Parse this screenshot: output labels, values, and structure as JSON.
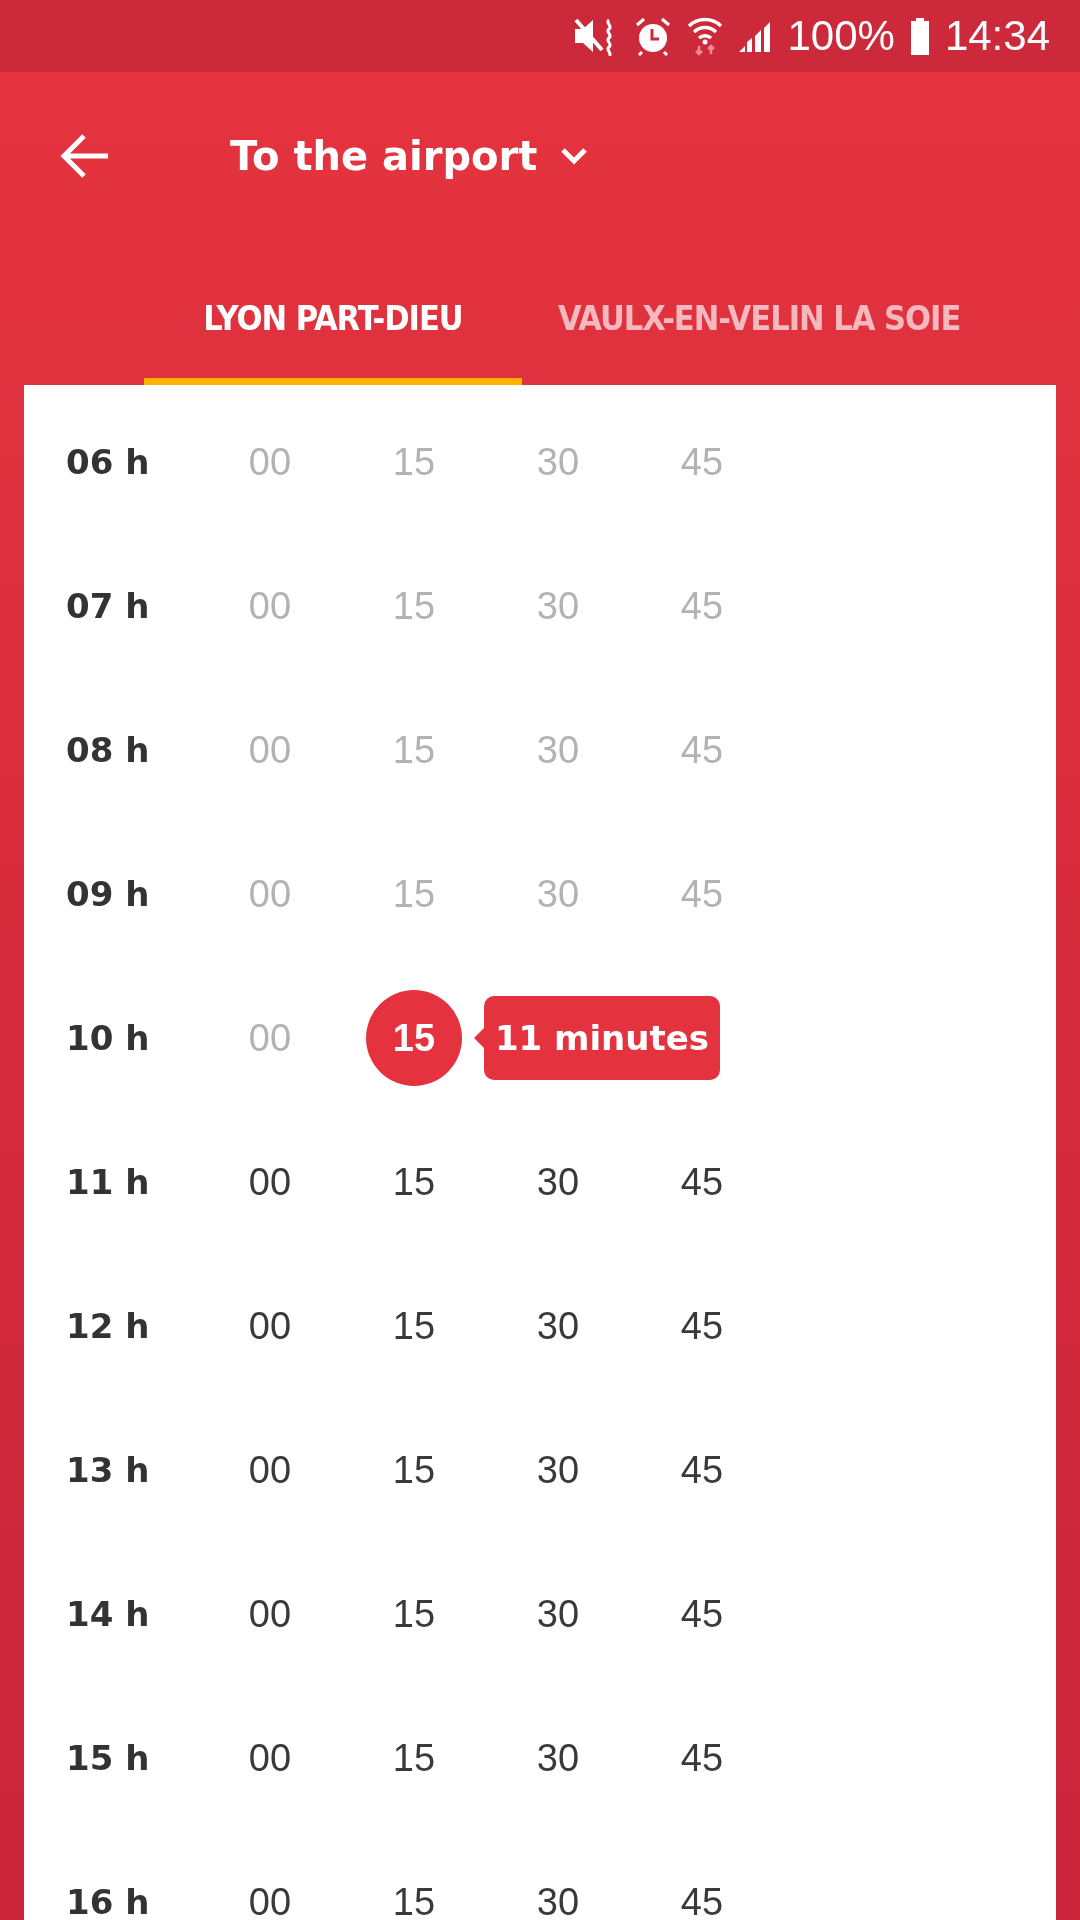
{
  "status_bar": {
    "battery": "100%",
    "time": "14:34"
  },
  "header": {
    "title": "To the airport"
  },
  "tabs": [
    {
      "label": "LYON PART-DIEU",
      "selected": true
    },
    {
      "label": "VAULX-EN-VELIN LA SOIE",
      "selected": false
    }
  ],
  "timetable": [
    {
      "hour": "06 h",
      "minutes": [
        {
          "label": "00",
          "past": true,
          "selected": false
        },
        {
          "label": "15",
          "past": true,
          "selected": false
        },
        {
          "label": "30",
          "past": true,
          "selected": false
        },
        {
          "label": "45",
          "past": true,
          "selected": false
        }
      ]
    },
    {
      "hour": "07 h",
      "minutes": [
        {
          "label": "00",
          "past": true,
          "selected": false
        },
        {
          "label": "15",
          "past": true,
          "selected": false
        },
        {
          "label": "30",
          "past": true,
          "selected": false
        },
        {
          "label": "45",
          "past": true,
          "selected": false
        }
      ]
    },
    {
      "hour": "08 h",
      "minutes": [
        {
          "label": "00",
          "past": true,
          "selected": false
        },
        {
          "label": "15",
          "past": true,
          "selected": false
        },
        {
          "label": "30",
          "past": true,
          "selected": false
        },
        {
          "label": "45",
          "past": true,
          "selected": false
        }
      ]
    },
    {
      "hour": "09 h",
      "minutes": [
        {
          "label": "00",
          "past": true,
          "selected": false
        },
        {
          "label": "15",
          "past": true,
          "selected": false
        },
        {
          "label": "30",
          "past": true,
          "selected": false
        },
        {
          "label": "45",
          "past": true,
          "selected": false
        }
      ]
    },
    {
      "hour": "10 h",
      "minutes": [
        {
          "label": "00",
          "past": true,
          "selected": false
        },
        {
          "label": "15",
          "past": false,
          "selected": true
        }
      ],
      "tooltip": "11 minutes"
    },
    {
      "hour": "11 h",
      "minutes": [
        {
          "label": "00",
          "past": false,
          "selected": false
        },
        {
          "label": "15",
          "past": false,
          "selected": false
        },
        {
          "label": "30",
          "past": false,
          "selected": false
        },
        {
          "label": "45",
          "past": false,
          "selected": false
        }
      ]
    },
    {
      "hour": "12 h",
      "minutes": [
        {
          "label": "00",
          "past": false,
          "selected": false
        },
        {
          "label": "15",
          "past": false,
          "selected": false
        },
        {
          "label": "30",
          "past": false,
          "selected": false
        },
        {
          "label": "45",
          "past": false,
          "selected": false
        }
      ]
    },
    {
      "hour": "13 h",
      "minutes": [
        {
          "label": "00",
          "past": false,
          "selected": false
        },
        {
          "label": "15",
          "past": false,
          "selected": false
        },
        {
          "label": "30",
          "past": false,
          "selected": false
        },
        {
          "label": "45",
          "past": false,
          "selected": false
        }
      ]
    },
    {
      "hour": "14 h",
      "minutes": [
        {
          "label": "00",
          "past": false,
          "selected": false
        },
        {
          "label": "15",
          "past": false,
          "selected": false
        },
        {
          "label": "30",
          "past": false,
          "selected": false
        },
        {
          "label": "45",
          "past": false,
          "selected": false
        }
      ]
    },
    {
      "hour": "15 h",
      "minutes": [
        {
          "label": "00",
          "past": false,
          "selected": false
        },
        {
          "label": "15",
          "past": false,
          "selected": false
        },
        {
          "label": "30",
          "past": false,
          "selected": false
        },
        {
          "label": "45",
          "past": false,
          "selected": false
        }
      ]
    },
    {
      "hour": "16 h",
      "minutes": [
        {
          "label": "00",
          "past": false,
          "selected": false
        },
        {
          "label": "15",
          "past": false,
          "selected": false
        },
        {
          "label": "30",
          "past": false,
          "selected": false
        },
        {
          "label": "45",
          "past": false,
          "selected": false
        }
      ]
    }
  ]
}
